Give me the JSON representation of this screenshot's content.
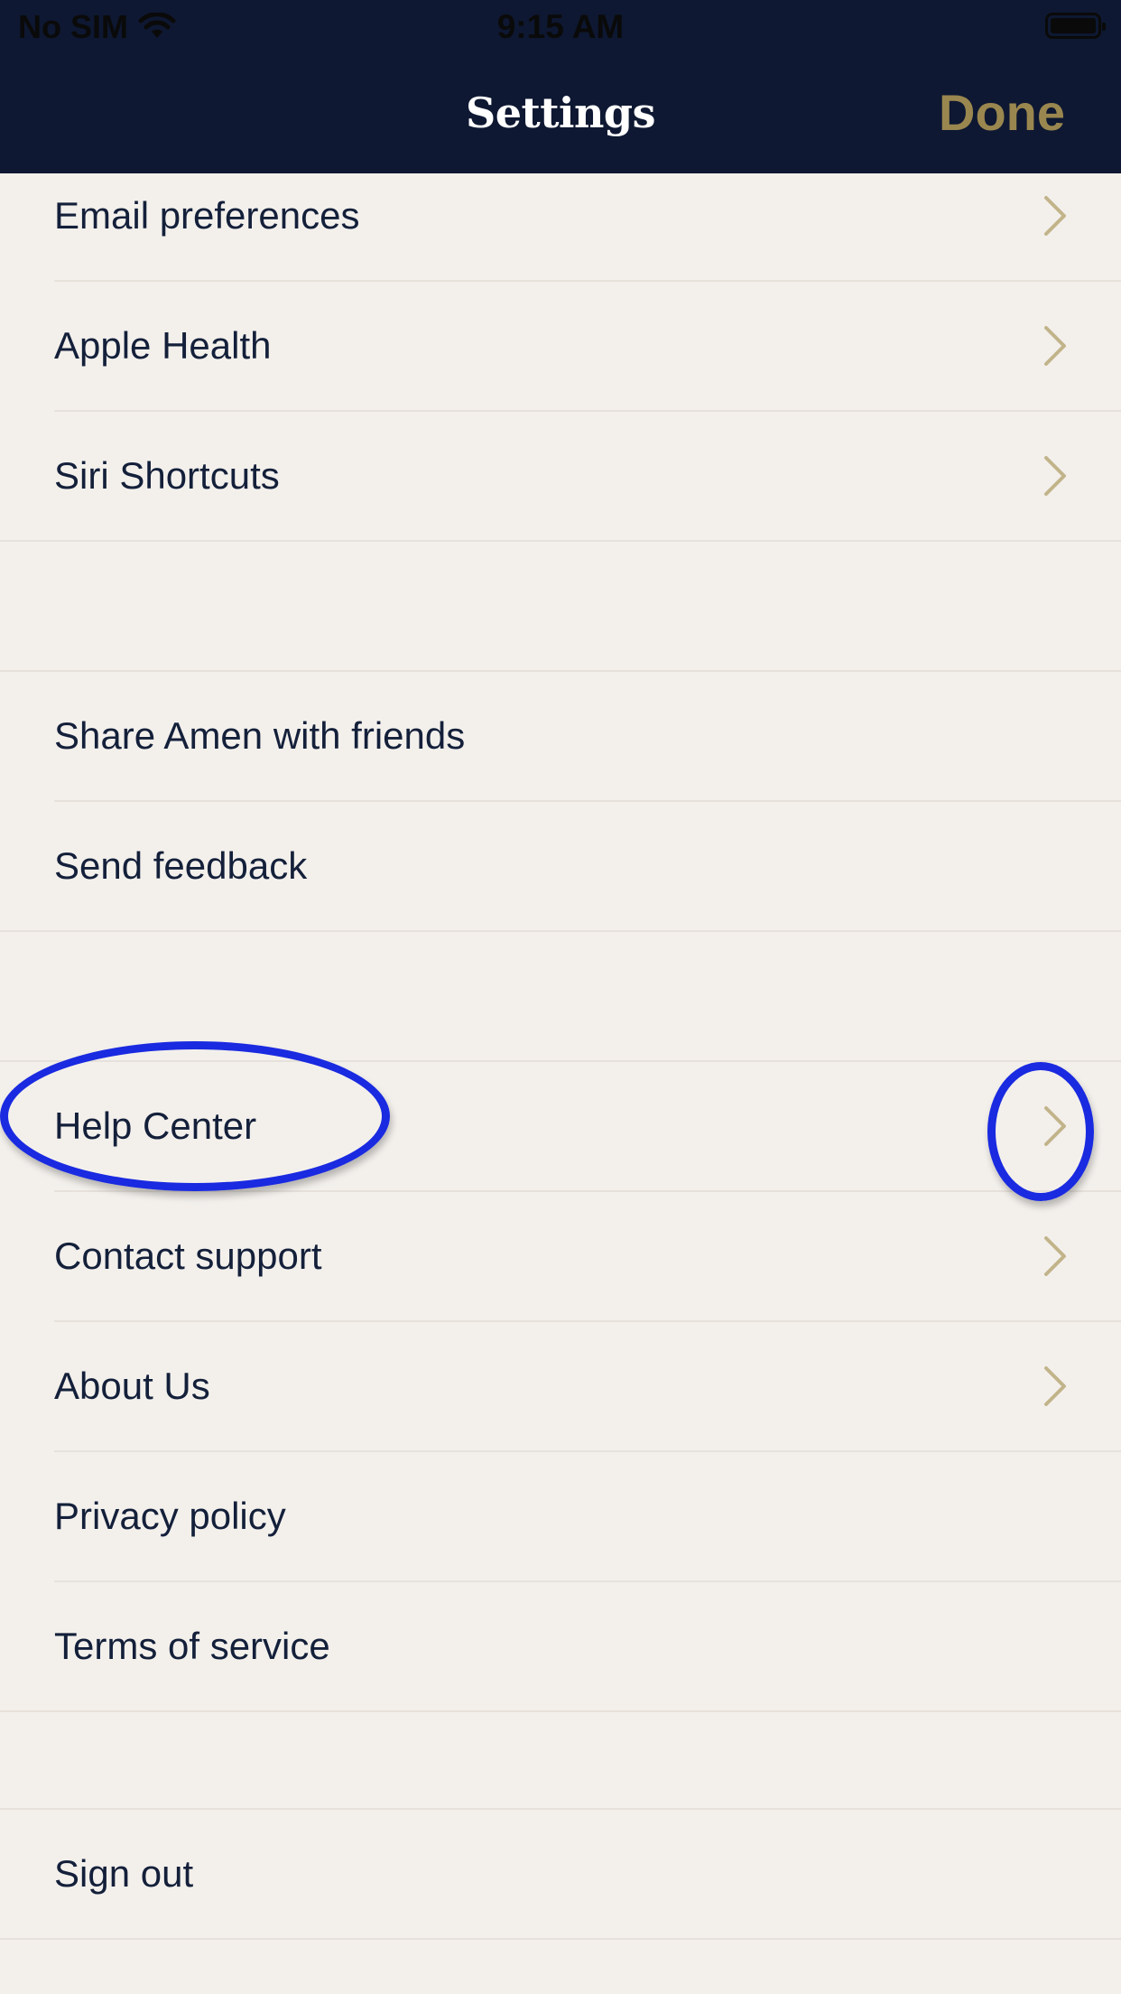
{
  "status_bar": {
    "carrier": "No SIM",
    "time": "9:15 AM",
    "wifi_icon": "wifi-icon",
    "battery_icon": "battery-icon"
  },
  "nav": {
    "title": "Settings",
    "done_label": "Done"
  },
  "sections": [
    {
      "items": [
        {
          "label": "Email preferences",
          "chevron": true
        },
        {
          "label": "Apple Health",
          "chevron": true
        },
        {
          "label": "Siri Shortcuts",
          "chevron": true
        }
      ]
    },
    {
      "items": [
        {
          "label": "Share Amen with friends",
          "chevron": false
        },
        {
          "label": "Send feedback",
          "chevron": false
        }
      ]
    },
    {
      "items": [
        {
          "label": "Help Center",
          "chevron": true
        },
        {
          "label": "Contact support",
          "chevron": true
        },
        {
          "label": "About Us",
          "chevron": true
        },
        {
          "label": "Privacy policy",
          "chevron": false
        },
        {
          "label": "Terms of service",
          "chevron": false
        }
      ]
    },
    {
      "items": [
        {
          "label": "Sign out",
          "chevron": false
        }
      ]
    }
  ],
  "colors": {
    "nav_background": "#0e1832",
    "accent_gold": "#9a874f",
    "chevron": "#c2b48a",
    "annotation_blue": "#1a2ae0"
  }
}
